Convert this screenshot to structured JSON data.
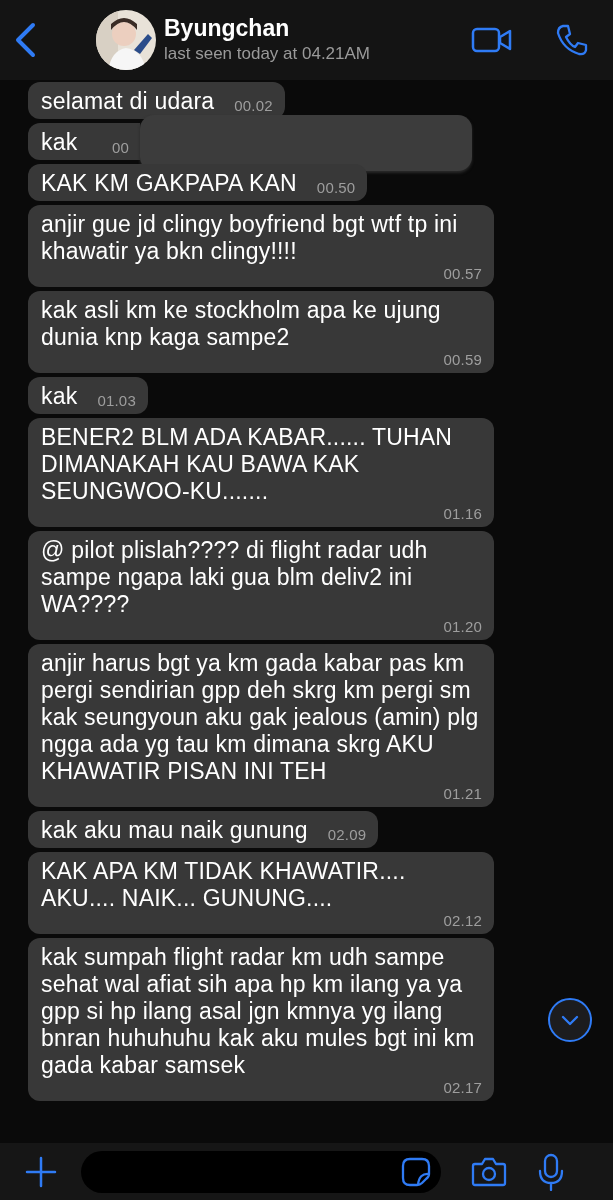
{
  "header": {
    "contact_name": "Byungchan",
    "last_seen": "last seen today at 04.21AM"
  },
  "messages": [
    {
      "text": "selamat di udara",
      "time": "00.02",
      "covered": false
    },
    {
      "text": "kak",
      "time": "00",
      "covered": true
    },
    {
      "text": "KAK KM GAKPAPA KAN",
      "time": "00.50",
      "covered": false
    },
    {
      "text": "anjir gue jd clingy boyfriend bgt wtf tp ini khawatir ya bkn clingy!!!!",
      "time": "00.57",
      "covered": false
    },
    {
      "text": "kak asli km ke stockholm apa ke ujung dunia knp kaga sampe2",
      "time": "00.59",
      "covered": false
    },
    {
      "text": "kak",
      "time": "01.03",
      "covered": false
    },
    {
      "text": "BENER2 BLM ADA KABAR...... TUHAN DIMANAKAH KAU BAWA KAK SEUNGWOO-KU.......",
      "time": "01.16",
      "covered": false
    },
    {
      "text": "@ pilot plislah???? di flight radar udh sampe ngapa laki gua blm deliv2 ini WA????",
      "time": "01.20",
      "covered": false
    },
    {
      "text": "anjir harus bgt ya km gada kabar pas km pergi sendirian gpp deh skrg km pergi sm kak seungyoun aku gak jealous (amin) plg ngga ada yg tau km dimana skrg AKU KHAWATIR PISAN INI TEH",
      "time": "01.21",
      "covered": false
    },
    {
      "text": "kak aku mau naik gunung",
      "time": "02.09",
      "covered": false
    },
    {
      "text": "KAK APA KM TIDAK KHAWATIR.... AKU.... NAIK... GUNUNG....",
      "time": "02.12",
      "covered": false
    },
    {
      "text": "kak sumpah flight radar km udh sampe sehat wal afiat sih apa hp km ilang ya ya gpp si hp ilang asal jgn kmnya yg ilang bnran huhuhuhu kak aku mules bgt ini km gada kabar samsek",
      "time": "02.17",
      "covered": false
    }
  ]
}
